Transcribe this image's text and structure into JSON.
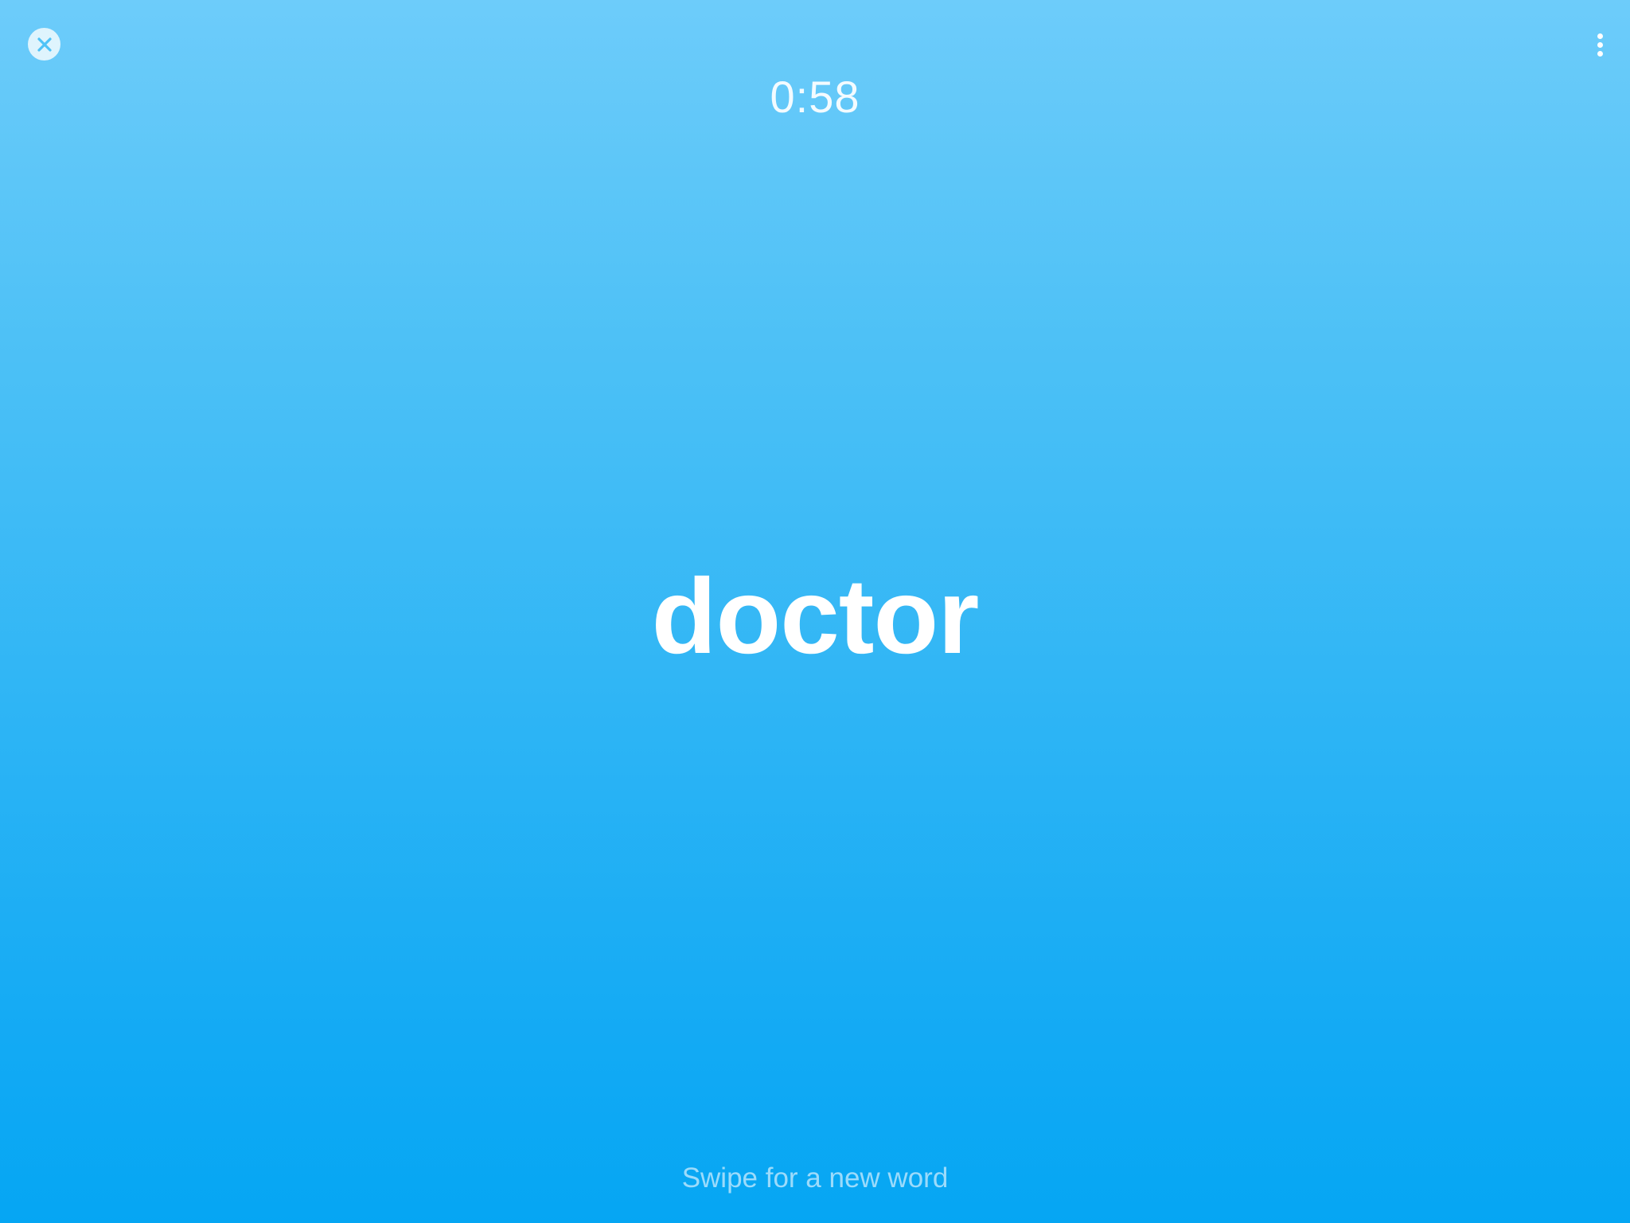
{
  "game": {
    "timer": "0:58",
    "current_word": "doctor",
    "hint": "Swipe for a new word"
  },
  "icons": {
    "close": "close-icon",
    "more": "more-vertical-icon"
  },
  "colors": {
    "background_top": "#6dccfa",
    "background_bottom": "#05a6f3",
    "text": "#ffffff",
    "close_button_bg": "#dff4fd",
    "close_icon": "#4fc3f7"
  }
}
